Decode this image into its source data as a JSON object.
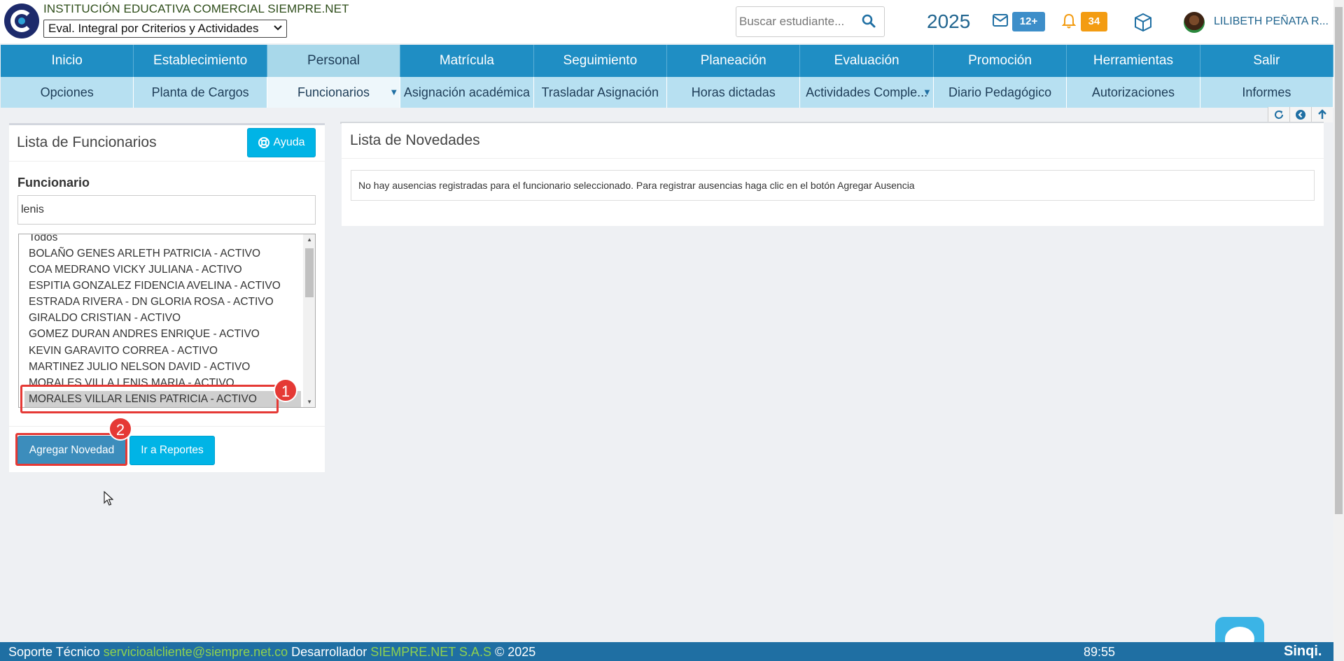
{
  "header": {
    "school_name": "INSTITUCIÓN EDUCATIVA COMERCIAL SIEMPRE.NET",
    "eval_select": "Eval. Integral por Criterios y Actividades",
    "search_placeholder": "Buscar estudiante...",
    "year": "2025",
    "mail_count": "12+",
    "notifications_count": "34",
    "user_name": "LILIBETH PEÑATA R...",
    "colors": {
      "mail_badge": "#3d8ec9",
      "bell_badge": "#f39c12"
    }
  },
  "nav_main": [
    {
      "label": "Inicio",
      "active": false
    },
    {
      "label": "Establecimiento",
      "active": false
    },
    {
      "label": "Personal",
      "active": true
    },
    {
      "label": "Matrícula",
      "active": false
    },
    {
      "label": "Seguimiento",
      "active": false
    },
    {
      "label": "Planeación",
      "active": false
    },
    {
      "label": "Evaluación",
      "active": false
    },
    {
      "label": "Promoción",
      "active": false
    },
    {
      "label": "Herramientas",
      "active": false
    },
    {
      "label": "Salir",
      "active": false
    }
  ],
  "nav_sub": [
    {
      "label": "Opciones"
    },
    {
      "label": "Planta de Cargos"
    },
    {
      "label": "Funcionarios",
      "active": true
    },
    {
      "label": "Asignación académica"
    },
    {
      "label": "Trasladar Asignación"
    },
    {
      "label": "Horas dictadas"
    },
    {
      "label": "Actividades Comple..."
    },
    {
      "label": "Diario Pedagógico"
    },
    {
      "label": "Autorizaciones"
    },
    {
      "label": "Informes"
    }
  ],
  "left_panel": {
    "title": "Lista de Funcionarios",
    "help_button": "Ayuda",
    "field_label": "Funcionario",
    "filter_value": "lenis",
    "options": [
      "Todos",
      "BOLAÑO GENES ARLETH PATRICIA - ACTIVO",
      "COA MEDRANO VICKY JULIANA - ACTIVO",
      "ESPITIA GONZALEZ FIDENCIA AVELINA - ACTIVO",
      "ESTRADA RIVERA - DN GLORIA ROSA - ACTIVO",
      "GIRALDO CRISTIAN - ACTIVO",
      "GOMEZ DURAN ANDRES ENRIQUE - ACTIVO",
      "KEVIN GARAVITO CORREA - ACTIVO",
      "MARTINEZ JULIO NELSON DAVID - ACTIVO",
      "MORALES VILLA LENIS MARIA - ACTIVO",
      "MORALES VILLAR LENIS PATRICIA - ACTIVO"
    ],
    "selected_option": "MORALES VILLAR LENIS PATRICIA - ACTIVO",
    "add_button": "Agregar Novedad",
    "reports_button": "Ir a Reportes"
  },
  "annotations": {
    "step1": "1",
    "step2": "2",
    "color": "#e53935"
  },
  "right_panel": {
    "title": "Lista de Novedades",
    "message": "No hay ausencias registradas para el funcionario seleccionado. Para registrar ausencias haga clic en el botón Agregar Ausencia"
  },
  "footer": {
    "support_label": "Soporte Técnico",
    "support_email": "servicioalcliente@siempre.net.co",
    "developer_label": "Desarrollador",
    "developer_name": "SIEMPRE.NET S.A.S",
    "copyright": "© 2025",
    "timer": "89:55",
    "brand": "Sinqi."
  }
}
